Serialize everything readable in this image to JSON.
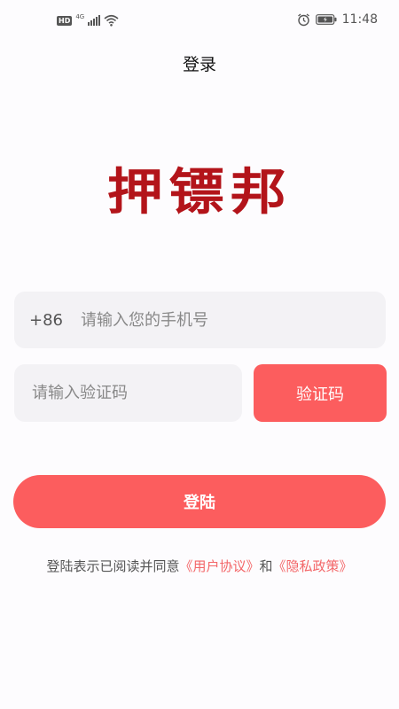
{
  "status_bar": {
    "hd": "HD",
    "network": "4G",
    "time": "11:48"
  },
  "header": {
    "title": "登录"
  },
  "logo": {
    "text": "押镖邦"
  },
  "form": {
    "country_code": "+86",
    "phone_placeholder": "请输入您的手机号",
    "code_placeholder": "请输入验证码",
    "code_button": "验证码",
    "login_button": "登陆"
  },
  "agreement": {
    "prefix": "登陆表示已阅读并同意",
    "user_agreement": "《用户协议》",
    "and": "和",
    "privacy_policy": "《隐私政策》"
  },
  "colors": {
    "accent": "#fc5d5e",
    "logo": "#b3141a",
    "link": "#f36668",
    "field_bg": "#f3f2f5"
  },
  "icons": [
    "hd-badge-icon",
    "signal-icon",
    "wifi-icon",
    "alarm-icon",
    "battery-icon"
  ]
}
